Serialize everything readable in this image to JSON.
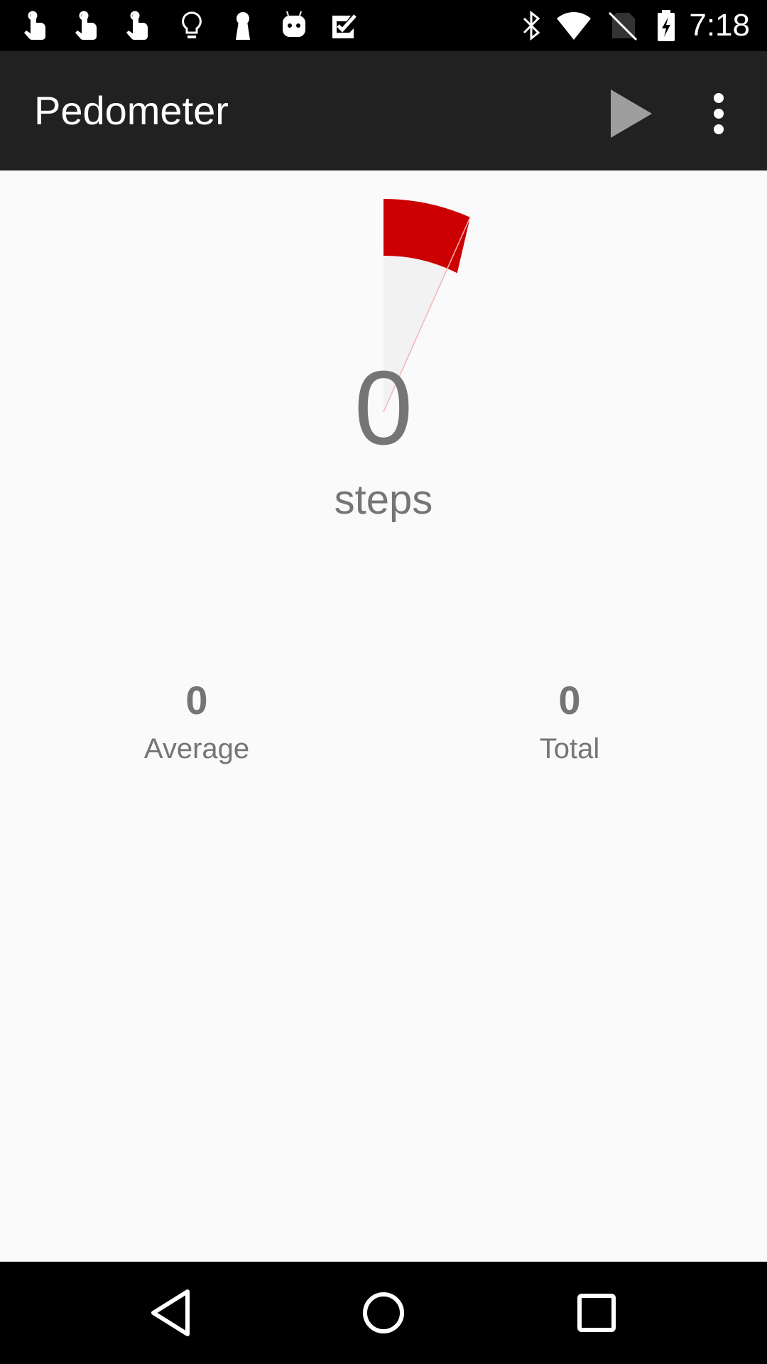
{
  "status_bar": {
    "time": "7:18",
    "notification_icons": [
      "touch-icon",
      "touch-icon",
      "touch-icon",
      "lightbulb-icon",
      "keyhole-icon",
      "android-icon",
      "checkbox-icon"
    ],
    "system_icons": [
      "bluetooth-icon",
      "wifi-icon",
      "no-sim-icon",
      "battery-charging-icon"
    ]
  },
  "toolbar": {
    "title": "Pedometer",
    "play_icon": "play-icon",
    "overflow_icon": "more-vert-icon"
  },
  "main": {
    "steps_count": "0",
    "steps_label": "steps",
    "gauge": {
      "progress_color": "#cc0000",
      "track_color": "#f2f2f2"
    }
  },
  "stats": {
    "average": {
      "value": "0",
      "label": "Average"
    },
    "total": {
      "value": "0",
      "label": "Total"
    }
  },
  "nav_bar": {
    "back_icon": "back-icon",
    "home_icon": "home-icon",
    "recents_icon": "recents-icon"
  }
}
